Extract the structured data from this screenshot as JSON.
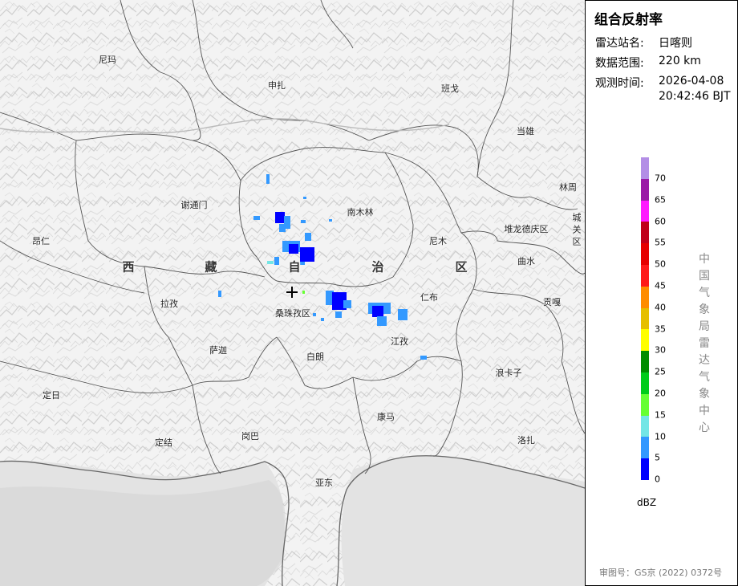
{
  "map": {
    "region_chars": [
      "西",
      "藏",
      "自",
      "治",
      "区"
    ],
    "places": [
      {
        "name": "尼玛"
      },
      {
        "name": "申扎"
      },
      {
        "name": "班戈"
      },
      {
        "name": "当雄"
      },
      {
        "name": "谢通门"
      },
      {
        "name": "南木林"
      },
      {
        "name": "林周"
      },
      {
        "name": "昂仁"
      },
      {
        "name": "尼木"
      },
      {
        "name": "堆龙德庆区"
      },
      {
        "name": "城关区"
      },
      {
        "name": "曲水"
      },
      {
        "name": "拉孜"
      },
      {
        "name": "仁布"
      },
      {
        "name": "贡嘎"
      },
      {
        "name": "桑珠孜区"
      },
      {
        "name": "萨迦"
      },
      {
        "name": "白朗"
      },
      {
        "name": "江孜"
      },
      {
        "name": "浪卡子"
      },
      {
        "name": "定日"
      },
      {
        "name": "康马"
      },
      {
        "name": "定结"
      },
      {
        "name": "岗巴"
      },
      {
        "name": "洛扎"
      },
      {
        "name": "亚东"
      }
    ]
  },
  "panel": {
    "title": "组合反射率",
    "station_label": "雷达站名:",
    "station_value": "日喀则",
    "range_label": "数据范围:",
    "range_value": "220 km",
    "time_label": "观测时间:",
    "time_date": "2026-04-08",
    "time_clock": "20:42:46 BJT",
    "legend_ticks": [
      "70",
      "65",
      "60",
      "55",
      "50",
      "45",
      "40",
      "35",
      "30",
      "25",
      "20",
      "15",
      "10",
      "5",
      "0"
    ],
    "legend_colors": [
      "#b38ee6",
      "#9a1aa6",
      "#ff1aff",
      "#c0001a",
      "#e60000",
      "#ff1a1a",
      "#ff8c00",
      "#e6bf00",
      "#ffff00",
      "#008c00",
      "#00cc1a",
      "#66ff33",
      "#73e6e6",
      "#3399ff",
      "#0000ff"
    ],
    "unit": "dBZ",
    "org_chars": [
      "中",
      "国",
      "气",
      "象",
      "局",
      "雷",
      "达",
      "气",
      "象",
      "中",
      "心"
    ],
    "approval": "审图号：GS京 (2022) 0372号"
  }
}
